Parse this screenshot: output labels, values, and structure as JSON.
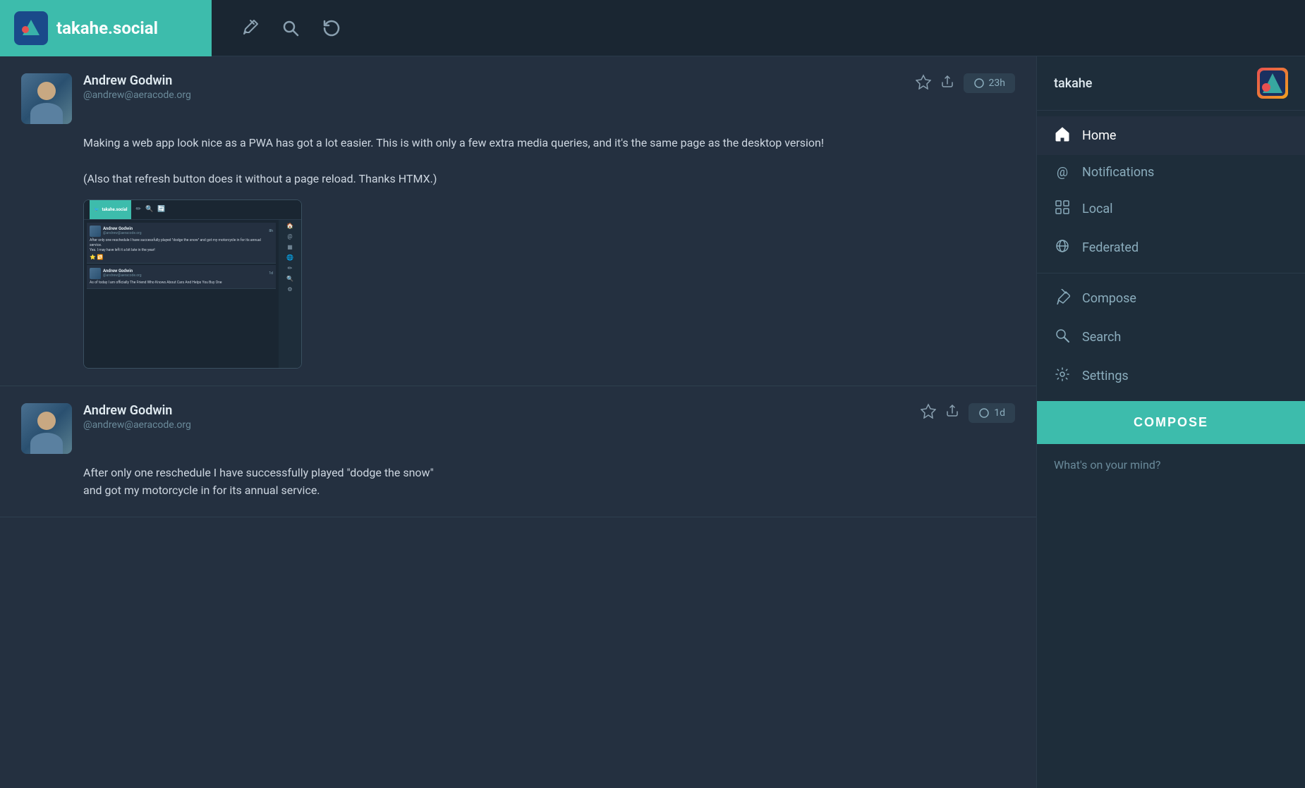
{
  "topbar": {
    "site_name": "takahe.social",
    "username": "takahe",
    "icons": {
      "compose": "✏",
      "search": "🔍",
      "refresh": "🔄"
    }
  },
  "sidebar": {
    "username": "takahe",
    "nav_items": [
      {
        "id": "home",
        "label": "Home",
        "icon": "🏠",
        "active": true
      },
      {
        "id": "notifications",
        "label": "Notifications",
        "icon": "@"
      },
      {
        "id": "local",
        "label": "Local",
        "icon": "▦"
      },
      {
        "id": "federated",
        "label": "Federated",
        "icon": "🌐"
      },
      {
        "id": "compose",
        "label": "Compose",
        "icon": "✏"
      },
      {
        "id": "search",
        "label": "Search",
        "icon": "🔍"
      },
      {
        "id": "settings",
        "label": "Settings",
        "icon": "⚙"
      }
    ],
    "compose_button_label": "COMPOSE",
    "compose_placeholder": "What's on your mind?"
  },
  "posts": [
    {
      "id": "post-1",
      "author": "Andrew Godwin",
      "handle": "@andrew@aeracode.org",
      "time": "23h",
      "content_lines": [
        "Making a web app look nice as a PWA has got a lot easier. This is with only a few extra media queries, and it's the same page as the desktop version!",
        "",
        "(Also that refresh button does it without a page reload. Thanks HTMX.)"
      ],
      "has_image": true,
      "mini_posts": [
        {
          "author": "Andrew Godwin",
          "handle": "@andrew@aeracode.org",
          "time": "8h",
          "text": "After only one reschedule I have successfully played \"dodge the snow\" and got my motorcycle in for its annual service.\n\nYes. I may have left it a bit late in the year!"
        },
        {
          "author": "Andrew Godwin",
          "handle": "@andrew@aeracode.org",
          "time": "1d",
          "text": "As of today I am officially The Friend Who Knows About Cars And Helps You Buy One"
        }
      ]
    },
    {
      "id": "post-2",
      "author": "Andrew Godwin",
      "handle": "@andrew@aeracode.org",
      "time": "1d",
      "content_lines": [
        "After only one reschedule I have successfully played \"dodge the snow\"",
        "and got my motorcycle in for its annual service."
      ],
      "has_image": false
    }
  ]
}
